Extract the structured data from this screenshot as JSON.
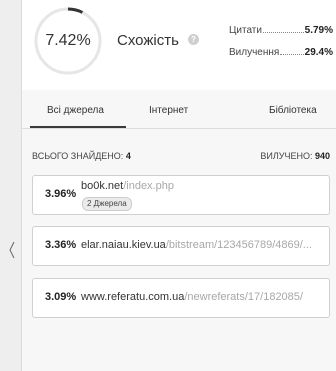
{
  "colors": {
    "accent": "#333333",
    "gauge_track": "#e6e6e6",
    "link_path": "#a8a8a8"
  },
  "header": {
    "similarity_value": "7.42%",
    "similarity_fraction": 0.0742,
    "similarity_label": "Схожість",
    "info_icon": "info-icon",
    "stats": [
      {
        "label": "Цитати",
        "value": "5.79%"
      },
      {
        "label": "Вилучення",
        "value": "29.4%"
      }
    ]
  },
  "tabs": [
    {
      "label": "Всі джерела",
      "active": true
    },
    {
      "label": "Інтернет",
      "active": false
    },
    {
      "label": "Бібліотека",
      "active": false
    }
  ],
  "summary": {
    "found_label": "ВСЬОГО ЗНАЙДЕНО:",
    "found_count": "4",
    "excluded_label": "ВИЛУЧЕНО:",
    "excluded_count": "940"
  },
  "sources": [
    {
      "percent": "3.96%",
      "domain": "bo0k.net",
      "path": "/index.php",
      "badge": "2 Джерела"
    },
    {
      "percent": "3.36%",
      "domain": "elar.naiau.kiev.ua",
      "path": "/bitstream/123456789/4869/...",
      "badge": ""
    },
    {
      "percent": "3.09%",
      "domain": "www.referatu.com.ua",
      "path": "/newreferats/17/182085/",
      "badge": ""
    }
  ],
  "sidebar": {
    "collapse_icon": "chevron-left-icon"
  }
}
